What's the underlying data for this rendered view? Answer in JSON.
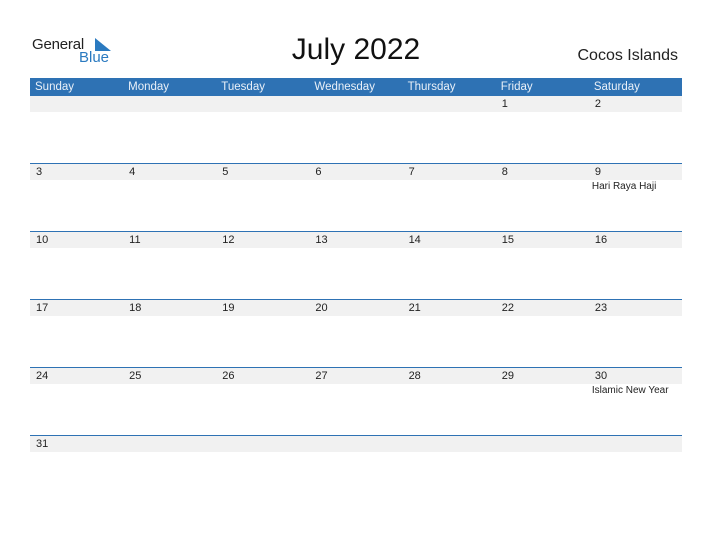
{
  "logo": {
    "line1": "General",
    "line2": "Blue"
  },
  "title": "July 2022",
  "country": "Cocos Islands",
  "colors": {
    "header": "#2e72b4",
    "accent": "#2a7ac0",
    "row_bg": "#f1f1f1"
  },
  "weekdays": [
    "Sunday",
    "Monday",
    "Tuesday",
    "Wednesday",
    "Thursday",
    "Friday",
    "Saturday"
  ],
  "weeks": [
    [
      {
        "d": ""
      },
      {
        "d": ""
      },
      {
        "d": ""
      },
      {
        "d": ""
      },
      {
        "d": ""
      },
      {
        "d": "1"
      },
      {
        "d": "2"
      }
    ],
    [
      {
        "d": "3"
      },
      {
        "d": "4"
      },
      {
        "d": "5"
      },
      {
        "d": "6"
      },
      {
        "d": "7"
      },
      {
        "d": "8"
      },
      {
        "d": "9",
        "e": "Hari Raya Haji"
      }
    ],
    [
      {
        "d": "10"
      },
      {
        "d": "11"
      },
      {
        "d": "12"
      },
      {
        "d": "13"
      },
      {
        "d": "14"
      },
      {
        "d": "15"
      },
      {
        "d": "16"
      }
    ],
    [
      {
        "d": "17"
      },
      {
        "d": "18"
      },
      {
        "d": "19"
      },
      {
        "d": "20"
      },
      {
        "d": "21"
      },
      {
        "d": "22"
      },
      {
        "d": "23"
      }
    ],
    [
      {
        "d": "24"
      },
      {
        "d": "25"
      },
      {
        "d": "26"
      },
      {
        "d": "27"
      },
      {
        "d": "28"
      },
      {
        "d": "29"
      },
      {
        "d": "30",
        "e": "Islamic New Year"
      }
    ],
    [
      {
        "d": "31"
      },
      {
        "d": ""
      },
      {
        "d": ""
      },
      {
        "d": ""
      },
      {
        "d": ""
      },
      {
        "d": ""
      },
      {
        "d": ""
      }
    ]
  ]
}
